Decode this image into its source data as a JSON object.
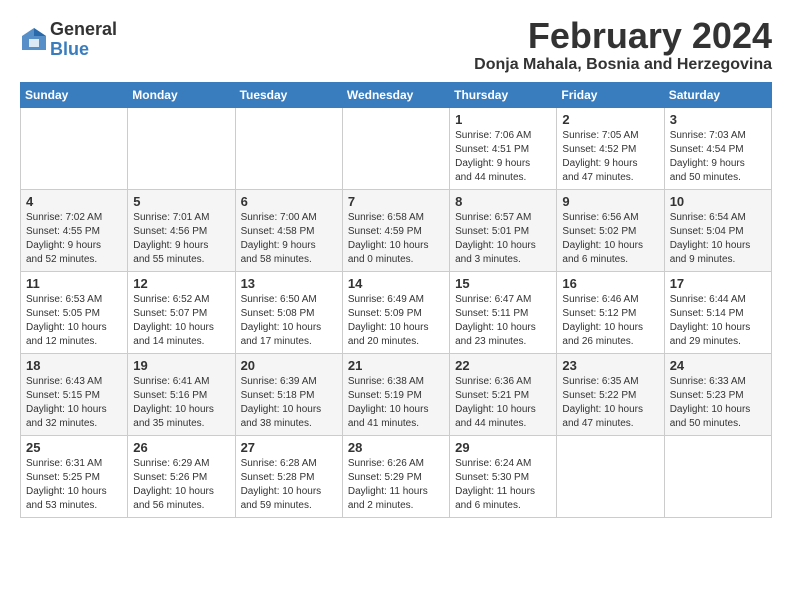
{
  "header": {
    "logo_general": "General",
    "logo_blue": "Blue",
    "month_year": "February 2024",
    "location": "Donja Mahala, Bosnia and Herzegovina"
  },
  "calendar": {
    "days_of_week": [
      "Sunday",
      "Monday",
      "Tuesday",
      "Wednesday",
      "Thursday",
      "Friday",
      "Saturday"
    ],
    "weeks": [
      [
        {
          "day": "",
          "info": ""
        },
        {
          "day": "",
          "info": ""
        },
        {
          "day": "",
          "info": ""
        },
        {
          "day": "",
          "info": ""
        },
        {
          "day": "1",
          "info": "Sunrise: 7:06 AM\nSunset: 4:51 PM\nDaylight: 9 hours\nand 44 minutes."
        },
        {
          "day": "2",
          "info": "Sunrise: 7:05 AM\nSunset: 4:52 PM\nDaylight: 9 hours\nand 47 minutes."
        },
        {
          "day": "3",
          "info": "Sunrise: 7:03 AM\nSunset: 4:54 PM\nDaylight: 9 hours\nand 50 minutes."
        }
      ],
      [
        {
          "day": "4",
          "info": "Sunrise: 7:02 AM\nSunset: 4:55 PM\nDaylight: 9 hours\nand 52 minutes."
        },
        {
          "day": "5",
          "info": "Sunrise: 7:01 AM\nSunset: 4:56 PM\nDaylight: 9 hours\nand 55 minutes."
        },
        {
          "day": "6",
          "info": "Sunrise: 7:00 AM\nSunset: 4:58 PM\nDaylight: 9 hours\nand 58 minutes."
        },
        {
          "day": "7",
          "info": "Sunrise: 6:58 AM\nSunset: 4:59 PM\nDaylight: 10 hours\nand 0 minutes."
        },
        {
          "day": "8",
          "info": "Sunrise: 6:57 AM\nSunset: 5:01 PM\nDaylight: 10 hours\nand 3 minutes."
        },
        {
          "day": "9",
          "info": "Sunrise: 6:56 AM\nSunset: 5:02 PM\nDaylight: 10 hours\nand 6 minutes."
        },
        {
          "day": "10",
          "info": "Sunrise: 6:54 AM\nSunset: 5:04 PM\nDaylight: 10 hours\nand 9 minutes."
        }
      ],
      [
        {
          "day": "11",
          "info": "Sunrise: 6:53 AM\nSunset: 5:05 PM\nDaylight: 10 hours\nand 12 minutes."
        },
        {
          "day": "12",
          "info": "Sunrise: 6:52 AM\nSunset: 5:07 PM\nDaylight: 10 hours\nand 14 minutes."
        },
        {
          "day": "13",
          "info": "Sunrise: 6:50 AM\nSunset: 5:08 PM\nDaylight: 10 hours\nand 17 minutes."
        },
        {
          "day": "14",
          "info": "Sunrise: 6:49 AM\nSunset: 5:09 PM\nDaylight: 10 hours\nand 20 minutes."
        },
        {
          "day": "15",
          "info": "Sunrise: 6:47 AM\nSunset: 5:11 PM\nDaylight: 10 hours\nand 23 minutes."
        },
        {
          "day": "16",
          "info": "Sunrise: 6:46 AM\nSunset: 5:12 PM\nDaylight: 10 hours\nand 26 minutes."
        },
        {
          "day": "17",
          "info": "Sunrise: 6:44 AM\nSunset: 5:14 PM\nDaylight: 10 hours\nand 29 minutes."
        }
      ],
      [
        {
          "day": "18",
          "info": "Sunrise: 6:43 AM\nSunset: 5:15 PM\nDaylight: 10 hours\nand 32 minutes."
        },
        {
          "day": "19",
          "info": "Sunrise: 6:41 AM\nSunset: 5:16 PM\nDaylight: 10 hours\nand 35 minutes."
        },
        {
          "day": "20",
          "info": "Sunrise: 6:39 AM\nSunset: 5:18 PM\nDaylight: 10 hours\nand 38 minutes."
        },
        {
          "day": "21",
          "info": "Sunrise: 6:38 AM\nSunset: 5:19 PM\nDaylight: 10 hours\nand 41 minutes."
        },
        {
          "day": "22",
          "info": "Sunrise: 6:36 AM\nSunset: 5:21 PM\nDaylight: 10 hours\nand 44 minutes."
        },
        {
          "day": "23",
          "info": "Sunrise: 6:35 AM\nSunset: 5:22 PM\nDaylight: 10 hours\nand 47 minutes."
        },
        {
          "day": "24",
          "info": "Sunrise: 6:33 AM\nSunset: 5:23 PM\nDaylight: 10 hours\nand 50 minutes."
        }
      ],
      [
        {
          "day": "25",
          "info": "Sunrise: 6:31 AM\nSunset: 5:25 PM\nDaylight: 10 hours\nand 53 minutes."
        },
        {
          "day": "26",
          "info": "Sunrise: 6:29 AM\nSunset: 5:26 PM\nDaylight: 10 hours\nand 56 minutes."
        },
        {
          "day": "27",
          "info": "Sunrise: 6:28 AM\nSunset: 5:28 PM\nDaylight: 10 hours\nand 59 minutes."
        },
        {
          "day": "28",
          "info": "Sunrise: 6:26 AM\nSunset: 5:29 PM\nDaylight: 11 hours\nand 2 minutes."
        },
        {
          "day": "29",
          "info": "Sunrise: 6:24 AM\nSunset: 5:30 PM\nDaylight: 11 hours\nand 6 minutes."
        },
        {
          "day": "",
          "info": ""
        },
        {
          "day": "",
          "info": ""
        }
      ]
    ]
  }
}
